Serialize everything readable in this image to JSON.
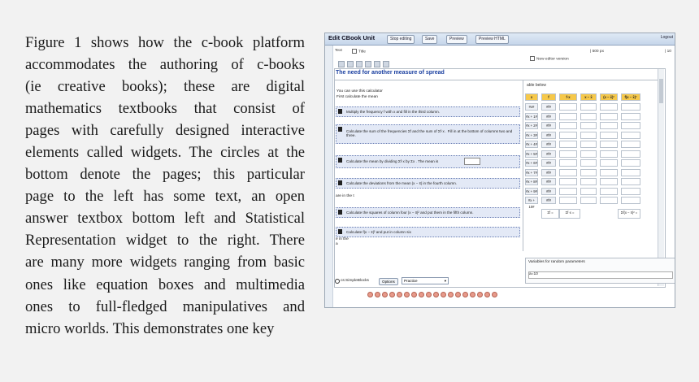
{
  "paragraph": {
    "lines": [
      "Figure 1 shows how the c-book platform",
      "accommodates the authoring of c-books",
      "(ie creative books); these are digital",
      "mathematics textbooks that consist of",
      "pages with carefully designed interactive",
      "elements called widgets. The circles at the",
      "bottom denote the pages; this particular",
      "page to the left has some text, an open",
      "answer textbox bottom left and Statistical",
      "Representation widget to the right. There",
      "are many more widgets ranging from basic",
      "ones like equation boxes and multimedia",
      "ones to full-fledged manipulatives and",
      "micro worlds. This demonstrates one key"
    ]
  },
  "screenshot": {
    "app_title": "Edit CBook Unit",
    "buttons": [
      "Stop editing",
      "Save",
      "Preview",
      "Preview HTML"
    ],
    "logout": "Logout",
    "toolbar": {
      "text_label": "Text",
      "title_label": "Title",
      "new_editor": "New editor version",
      "width1": "| 500 px",
      "width2": "| 10"
    },
    "heading": "The need for another measure of spread",
    "intro": [
      "You can use this calculator",
      "First calculate the mean"
    ],
    "steps": [
      "Multiply the frequency  f  with  x  and fill in the third column.",
      "Calculate the sum of the frequencies  Σf  and the sum of  Σf·x . Fill in at the bottom of columns two and three.",
      "Calculate the mean by dividing  Σf·x  by  Σx . The mean is",
      "Calculate the deviations from the mean  |x − x̄|  in the fourth column.",
      "Calculate the squares of column four  |x − x̄|²  and put them in the fifth column.",
      "Calculate  f|x − x̄|²  and put in column six"
    ],
    "side_notes": [
      "are in the t",
      "e in the",
      "a"
    ],
    "table_caption": "able below",
    "table_header": [
      "x",
      "f",
      "f·x",
      "x − x̄",
      "(x − x̄)²",
      "f(x − x̄)²"
    ],
    "table_rows": [
      "#x#",
      "#x + 1#",
      "#x + 2#",
      "#x + 3#",
      "#x + 4#",
      "#x + 5#",
      "#x + 6#",
      "#x + 7#",
      "#x + 8#",
      "#x + 9#",
      "#x + 10#"
    ],
    "table_f": [
      "#f#",
      "#f#",
      "#f#",
      "#f#",
      "#f#",
      "#f#",
      "#f#",
      "#f#",
      "#f#",
      "#f#",
      "#f#"
    ],
    "table_sums": [
      "Σf =",
      "Σf·x =",
      "Σf(x − x̄)² ="
    ],
    "variables_label": "Variables for random parameters",
    "variables_value": "a=10",
    "mode": {
      "radio_label": "cs:SimpleBlocks",
      "options_button": "Options",
      "select_value": "Practice"
    },
    "page_count": 18
  }
}
